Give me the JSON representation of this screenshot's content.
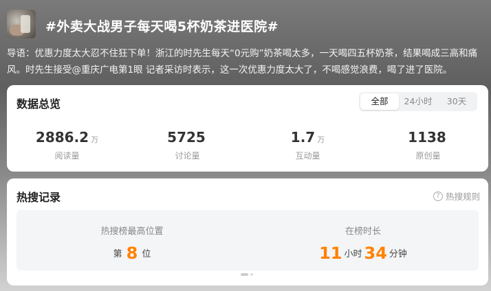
{
  "topic": {
    "title": "#外卖大战男子每天喝5杯奶茶进医院#",
    "intro": "导语：优惠力度太大忍不住狂下单！浙江的时先生每天“0元购”奶茶喝太多，一天喝四五杯奶茶，结果喝成三高和痛风。时先生接受@重庆广电第1眼 记者采访时表示，这一次优惠力度太大了，不喝感觉浪费，喝了进了医院。"
  },
  "overview": {
    "title": "数据总览",
    "tabs": [
      "全部",
      "24小时",
      "30天"
    ],
    "active_tab": "全部",
    "stats": [
      {
        "value": "2886.2",
        "unit": "万",
        "label": "阅读量"
      },
      {
        "value": "5725",
        "unit": "",
        "label": "讨论量"
      },
      {
        "value": "1.7",
        "unit": "万",
        "label": "互动量"
      },
      {
        "value": "1138",
        "unit": "",
        "label": "原创量"
      }
    ]
  },
  "records": {
    "title": "热搜记录",
    "rules_link": "热搜规则",
    "rules_icon": "help-circle-icon",
    "peak": {
      "label": "热搜榜最高位置",
      "prefix": "第",
      "value": "8",
      "suffix": "位"
    },
    "duration": {
      "label": "在榜时长",
      "hours": "11",
      "hours_unit": "小时",
      "minutes": "34",
      "minutes_unit": "分钟"
    }
  },
  "colors": {
    "accent": "#ff8200"
  }
}
